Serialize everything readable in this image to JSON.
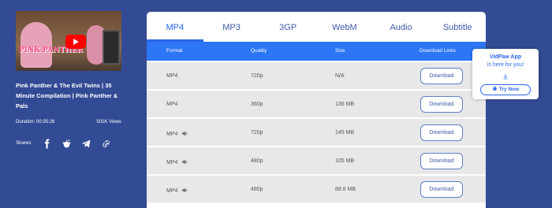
{
  "video": {
    "title": "Pink Panther & The Evil Twins | 35 Minute Compilation | Pink Panther & Pals",
    "duration": "Duration: 00:35:26",
    "views": "501K Views",
    "thumbnail_logo": "PINK PANTHER"
  },
  "share": {
    "label": "Shares:",
    "icons": [
      "facebook-icon",
      "reddit-icon",
      "telegram-icon",
      "link-icon"
    ]
  },
  "tabs": [
    "MP4",
    "MP3",
    "3GP",
    "WebM",
    "Audio",
    "Subtitle"
  ],
  "active_tab": "MP4",
  "table": {
    "headers": {
      "format": "Format",
      "quality": "Quality",
      "size": "Size",
      "links": "Download Links"
    },
    "rows": [
      {
        "format": "MP4",
        "quality": "720p",
        "size": "N/A",
        "muted": false,
        "button": "Download"
      },
      {
        "format": "MP4",
        "quality": "360p",
        "size": "136 MB",
        "muted": false,
        "button": "Download"
      },
      {
        "format": "MP4",
        "quality": "720p",
        "size": "145 MB",
        "muted": true,
        "button": "Download"
      },
      {
        "format": "MP4",
        "quality": "480p",
        "size": "105 MB",
        "muted": true,
        "button": "Download"
      },
      {
        "format": "MP4",
        "quality": "480p",
        "size": "88.6 MB",
        "muted": true,
        "button": "Download"
      }
    ]
  },
  "popup": {
    "title": "VidPaw App",
    "subtitle": "is here for you!",
    "button": "Try Now"
  },
  "colors": {
    "background": "#334b95",
    "accent": "#2b66ef",
    "header_bar": "#2d76f5",
    "row_bg": "#e8e8e8"
  }
}
